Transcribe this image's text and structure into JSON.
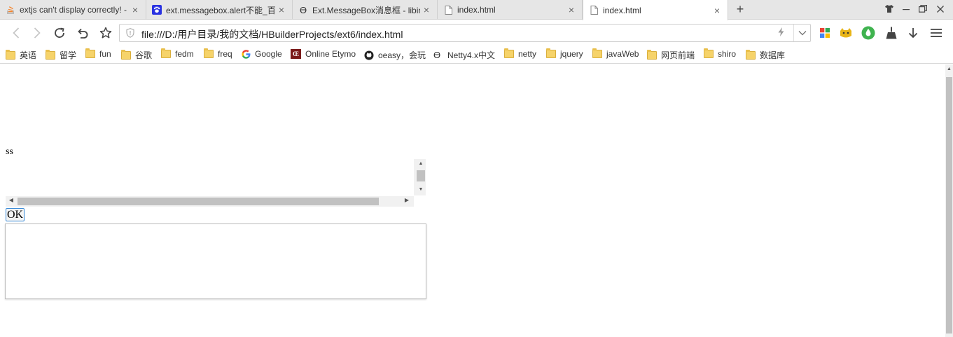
{
  "tabs": [
    {
      "title": "extjs can't display correctly! -",
      "icon": "stackoverflow-icon",
      "active": false
    },
    {
      "title": "ext.messagebox.alert不能_百度",
      "icon": "baidu-paw-icon",
      "active": false
    },
    {
      "title": "Ext.MessageBox消息框 - libin",
      "icon": "omega-icon",
      "active": false
    },
    {
      "title": "index.html",
      "icon": "page-icon",
      "active": false
    },
    {
      "title": "index.html",
      "icon": "page-icon",
      "active": true
    }
  ],
  "toolbar": {
    "url": "file:///D:/用户目录/我的文档/HBuilderProjects/ext6/index.html"
  },
  "bookmarks": [
    {
      "label": "英语",
      "icon": "folder-icon"
    },
    {
      "label": "留学",
      "icon": "folder-icon"
    },
    {
      "label": "fun",
      "icon": "folder-icon"
    },
    {
      "label": "谷歌",
      "icon": "folder-icon"
    },
    {
      "label": "fedm",
      "icon": "folder-icon"
    },
    {
      "label": "freq",
      "icon": "folder-icon"
    },
    {
      "label": "Google",
      "icon": "google-icon"
    },
    {
      "label": "Online Etymo",
      "icon": "etymonline-icon"
    },
    {
      "label": "oeasy，会玩",
      "icon": "github-icon"
    },
    {
      "label": "Netty4.x中文",
      "icon": "omega-icon"
    },
    {
      "label": "netty",
      "icon": "folder-icon"
    },
    {
      "label": "jquery",
      "icon": "folder-icon"
    },
    {
      "label": "javaWeb",
      "icon": "folder-icon"
    },
    {
      "label": "网页前端",
      "icon": "folder-icon"
    },
    {
      "label": "shiro",
      "icon": "folder-icon"
    },
    {
      "label": "数据库",
      "icon": "folder-icon"
    }
  ],
  "page": {
    "text": "ss",
    "ok_label": "OK"
  },
  "colors": {
    "tabstrip_bg": "#e6e6e6",
    "button_focus": "#3b8bd8",
    "folder": "#f6d36a"
  }
}
